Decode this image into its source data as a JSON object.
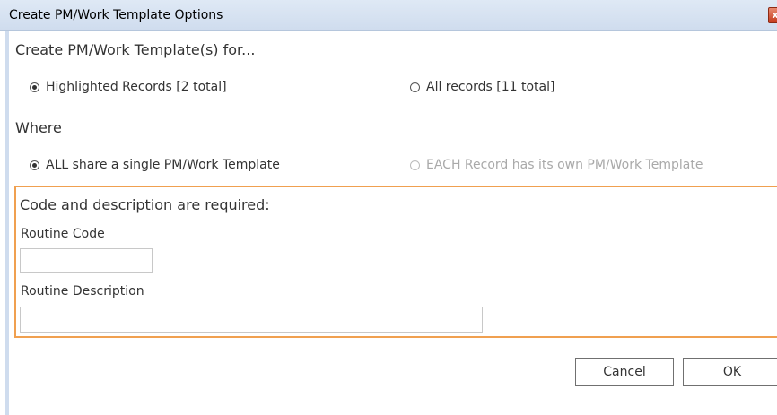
{
  "window": {
    "title": "Create PM/Work Template Options",
    "close_glyph": "x"
  },
  "section_for": {
    "title": "Create PM/Work Template(s) for...",
    "options": [
      {
        "label": "Highlighted Records [2 total]",
        "selected": true
      },
      {
        "label": "All records [11 total]",
        "selected": false
      }
    ]
  },
  "section_where": {
    "title": "Where",
    "options": [
      {
        "label": "ALL share a single PM/Work Template",
        "selected": true
      },
      {
        "label": "EACH Record has its own PM/Work Template",
        "selected": false,
        "disabled": true
      }
    ]
  },
  "required": {
    "title": "Code and description are required:",
    "routine_code": {
      "label": "Routine Code",
      "value": ""
    },
    "routine_description": {
      "label": "Routine Description",
      "value": ""
    }
  },
  "buttons": {
    "cancel": "Cancel",
    "ok": "OK"
  },
  "colors": {
    "required_border": "#f0a050",
    "titlebar": "#dfe9f5"
  }
}
